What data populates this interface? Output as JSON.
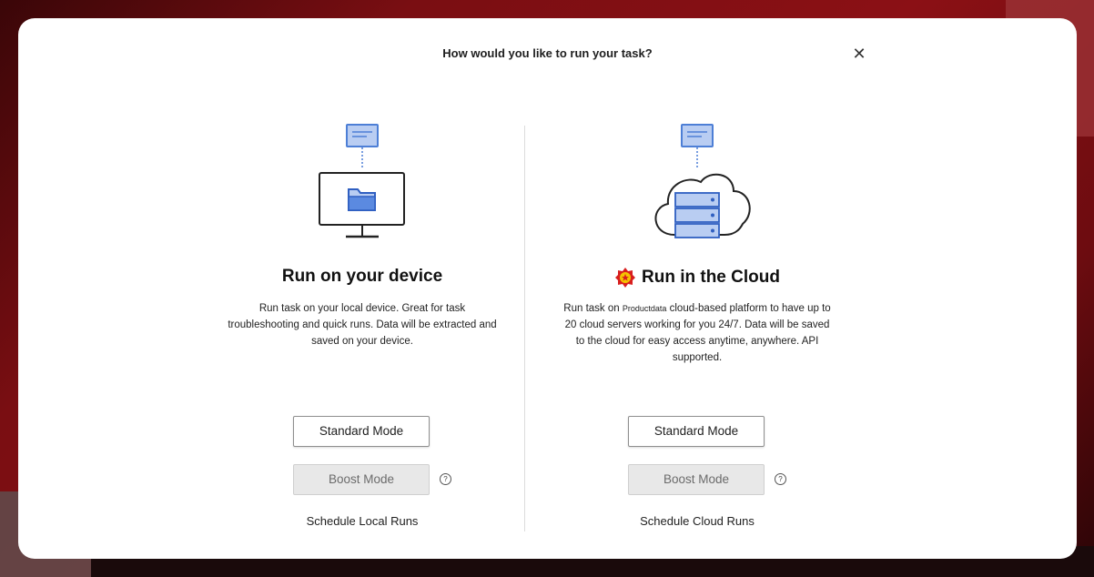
{
  "dialog": {
    "title": "How would you like to run your task?",
    "close_icon": "close-icon",
    "close_glyph": "✕"
  },
  "local": {
    "illustration": "monitor-folder-icon",
    "title": "Run on your device",
    "description": "Run task on your local device. Great for task troubleshooting and quick runs. Data will be extracted and saved on your device.",
    "standard_label": "Standard Mode",
    "boost_label": "Boost Mode",
    "help_icon": "help-icon",
    "help_glyph": "?",
    "schedule_label": "Schedule Local Runs"
  },
  "cloud": {
    "illustration": "cloud-server-icon",
    "logo": "brand-logo-icon",
    "title": "Run in the Cloud",
    "description_before": "Run task on ",
    "description_brand": "Productdata",
    "description_after": " cloud-based platform to have up to 20 cloud servers working for you 24/7. Data will be saved to the cloud for easy access anytime, anywhere. API supported.",
    "standard_label": "Standard Mode",
    "boost_label": "Boost Mode",
    "help_icon": "help-icon",
    "help_glyph": "?",
    "schedule_label": "Schedule Cloud Runs"
  },
  "colors": {
    "background": "#7a0e12",
    "illustration_blue": "#4d7fd6",
    "illustration_light": "#b9cdf2",
    "logo_red": "#d81e1e",
    "logo_yellow": "#f5c400"
  }
}
